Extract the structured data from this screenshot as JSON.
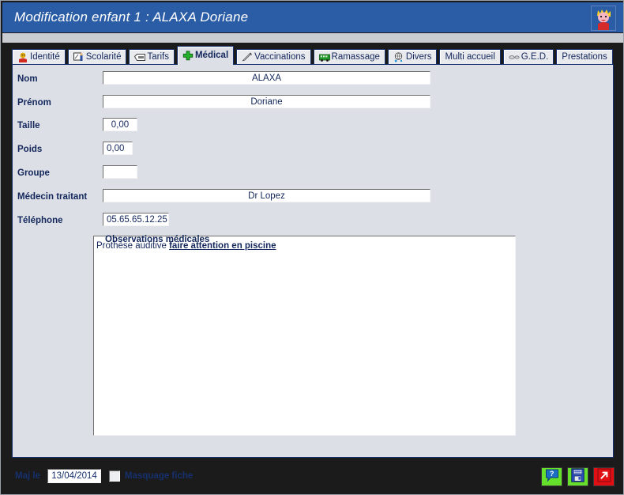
{
  "window": {
    "title": "Modification enfant 1 : ALAXA Doriane",
    "title_icon": "child-face-icon"
  },
  "tabs": [
    {
      "id": "identite",
      "label": "Identité",
      "icon": "person-red-icon",
      "active": false
    },
    {
      "id": "scolarite",
      "label": "Scolarité",
      "icon": "school-board-icon",
      "active": false
    },
    {
      "id": "tarifs",
      "label": "Tarifs",
      "icon": "price-tag-icon",
      "active": false
    },
    {
      "id": "medical",
      "label": "Médical",
      "icon": "green-cross-icon",
      "active": true
    },
    {
      "id": "vaccinations",
      "label": "Vaccinations",
      "icon": "syringe-icon",
      "active": false
    },
    {
      "id": "ramassage",
      "label": "Ramassage",
      "icon": "green-bus-icon",
      "active": false
    },
    {
      "id": "divers",
      "label": "Divers",
      "icon": "globe-cart-icon",
      "active": false
    },
    {
      "id": "multiaccueil",
      "label": "Multi accueil",
      "icon": "",
      "active": false
    },
    {
      "id": "ged",
      "label": "G.E.D.",
      "icon": "glasses-icon",
      "active": false
    },
    {
      "id": "prestations",
      "label": "Prestations",
      "icon": "",
      "active": false
    }
  ],
  "form": {
    "nom": {
      "label": "Nom",
      "value": "ALAXA"
    },
    "prenom": {
      "label": "Prénom",
      "value": "Doriane"
    },
    "taille": {
      "label": "Taille",
      "value": "0,00"
    },
    "poids": {
      "label": "Poids",
      "value": "0,00"
    },
    "groupe": {
      "label": "Groupe",
      "value": ""
    },
    "medecin": {
      "label": "Médecin traitant",
      "value": "Dr Lopez"
    },
    "telephone": {
      "label": "Téléphone",
      "value": "05.65.65.12.25"
    }
  },
  "observations": {
    "title": "Observations médicales",
    "text_plain": "Prothèse auditive ",
    "text_emphasis": "faire attention en piscine"
  },
  "footer": {
    "maj_label": "Maj le",
    "maj_value": "13/04/2014",
    "mask_label": "Masquage fiche",
    "mask_checked": false,
    "buttons": [
      {
        "id": "help",
        "name": "help-button",
        "icon": "question-bubble-icon",
        "color": "#66e02a"
      },
      {
        "id": "save",
        "name": "save-button",
        "icon": "floppy-disk-icon",
        "color": "#66e02a"
      },
      {
        "id": "exit",
        "name": "exit-button",
        "icon": "exit-arrow-icon",
        "color": "#e10f14"
      }
    ]
  },
  "colors": {
    "titlebar": "#2b5ca6",
    "panel_bg": "#dcdfe5",
    "dark_bg": "#1b1b1b",
    "label_text": "#13275c",
    "tab_border": "#15306b"
  }
}
